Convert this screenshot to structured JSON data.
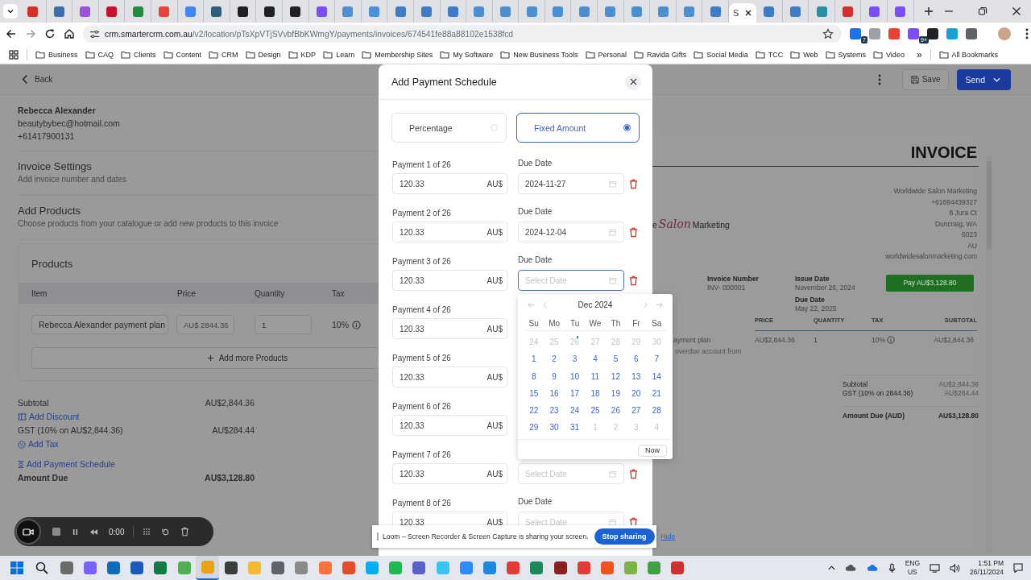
{
  "browser": {
    "tabs": [
      {
        "color": "#d93025",
        "selected": false
      },
      {
        "color": "#3b6db3",
        "selected": false
      },
      {
        "color": "#9b51e0",
        "selected": false
      },
      {
        "color": "#c8102e",
        "selected": false
      },
      {
        "color": "#1e8e3e",
        "selected": false
      },
      {
        "color": "#ea4335",
        "selected": false
      },
      {
        "color": "#4285f4",
        "selected": false
      },
      {
        "color": "#2d5f7a",
        "selected": false
      },
      {
        "color": "#202124",
        "selected": false
      },
      {
        "color": "#202124",
        "selected": false
      },
      {
        "color": "#202124",
        "selected": false
      },
      {
        "color": "#7c4dff",
        "selected": false
      },
      {
        "color": "#4a90d9",
        "selected": false
      },
      {
        "color": "#4a90d9",
        "selected": false
      },
      {
        "color": "#3d7cc9",
        "selected": false
      },
      {
        "color": "#3d7cc9",
        "selected": false
      },
      {
        "color": "#3d7cc9",
        "selected": false
      },
      {
        "color": "#4a8fd4",
        "selected": false
      },
      {
        "color": "#4a8fd4",
        "selected": false
      },
      {
        "color": "#4a8fd4",
        "selected": false
      },
      {
        "color": "#4a8fd4",
        "selected": false
      },
      {
        "color": "#4a8fd4",
        "selected": false
      },
      {
        "color": "#4a8fd4",
        "selected": false
      },
      {
        "color": "#4a8fd4",
        "selected": false
      },
      {
        "color": "#4a8fd4",
        "selected": false
      },
      {
        "color": "#4a8fd4",
        "selected": false
      },
      {
        "color": "#3d7cc9",
        "selected": false
      },
      {
        "title": "S",
        "selected": true
      },
      {
        "color": "#3d7cc9",
        "selected": false
      },
      {
        "color": "#3d7cc9",
        "selected": false
      },
      {
        "color": "#2a8fa0",
        "selected": false
      },
      {
        "color": "#d32f2f",
        "selected": false
      },
      {
        "color": "#7c4dff",
        "selected": false
      },
      {
        "color": "#7c4dff",
        "selected": false
      }
    ],
    "url": {
      "host": "crm.smartercrm.com.au",
      "path": "/v2/location/pTsXpVTjSVvbfBbKWmgY/payments/invoices/674541fe88a88102e1538fcd"
    },
    "extensions": [
      {
        "color": "#1a73e8",
        "badge": "7"
      },
      {
        "color": "#9aa0a6"
      },
      {
        "color": "#e94235"
      },
      {
        "color": "#7c4dff",
        "badge": "9+"
      },
      {
        "color": "#202124"
      },
      {
        "color": "#1a9fd8"
      },
      {
        "color": "#5f6368"
      }
    ],
    "bookmarks": [
      "Business",
      "CAQ",
      "Clients",
      "Content",
      "CRM",
      "Design",
      "KDP",
      "Learn",
      "Membership Sites",
      "My Software",
      "New Business Tools",
      "Personal",
      "Ravida Gifts",
      "Social Media",
      "TCC",
      "Web",
      "Systems",
      "Video"
    ],
    "overflow": "»",
    "all_bookmarks": "All Bookmarks"
  },
  "page": {
    "back": "Back",
    "save": "Save",
    "send": "Send",
    "customer": {
      "name": "Rebecca Alexander",
      "email": "beautybybec@hotmail.com",
      "phone": "+61417900131"
    },
    "sections": [
      {
        "title": "Invoice Settings",
        "subtitle": "Add invoice number and dates"
      },
      {
        "title": "Add Products",
        "subtitle": "Choose products from your catalogue or add new products to this invoice"
      }
    ],
    "products": {
      "title": "Products",
      "columns": [
        "Item",
        "Price",
        "Quantity",
        "Tax"
      ],
      "row": {
        "item": "Rebecca Alexander payment plan",
        "price": "AU$ 2844.36",
        "quantity": "1",
        "tax": "10%"
      },
      "add": "Add more Products"
    },
    "summary": [
      {
        "kind": "row",
        "label": "Subtotal",
        "value": "AU$2,844.36"
      },
      {
        "kind": "discount",
        "label": "Add Discount"
      },
      {
        "kind": "row",
        "label": "GST (10% on AU$2,844.36)",
        "value": "AU$284.44"
      },
      {
        "kind": "tax",
        "label": "Add Tax"
      },
      {
        "kind": "schedule",
        "label": "Add Payment Schedule"
      },
      {
        "kind": "total",
        "label": "Amount Due",
        "value": "AU$3,128.80"
      }
    ]
  },
  "invoice": {
    "heading": "INVOICE",
    "logo": {
      "lead": "e",
      "script": "Salon",
      "tail": "Marketing"
    },
    "company": [
      "Worldwide Salon Marketing",
      "+61894439327",
      "8 Jura Ct",
      "Duncraig, WA",
      "6023",
      "AU",
      "worldwidesalonmarketing.com"
    ],
    "number": {
      "label": "Invoice Number",
      "value": "INV- 000001"
    },
    "dates": [
      {
        "label": "Issue Date",
        "value": "November 26, 2024"
      },
      {
        "label": "Due Date",
        "value": "May 22, 2025"
      }
    ],
    "pay": "Pay AU$3,128.80",
    "columns": [
      "PRICE",
      "QUANTITY",
      "TAX",
      "SUBTOTAL"
    ],
    "item": {
      "name": "ayment plan",
      "note": "overdue account from",
      "price": "AU$2,844.36",
      "quantity": "1",
      "tax": "10%",
      "subtotal": "AU$2,844.36"
    },
    "totals": [
      {
        "label": "Subtotal",
        "value": "AU$2,844.36",
        "bold": false
      },
      {
        "label": "GST (10% on 2844.36)",
        "value": "AU$284.44",
        "bold": false
      },
      {
        "label": "Amount Due (AUD)",
        "value": "AU$3,128.80",
        "bold": true
      }
    ]
  },
  "modal": {
    "title": "Add Payment Schedule",
    "options": [
      {
        "label": "Percentage",
        "selected": false
      },
      {
        "label": "Fixed Amount",
        "selected": true
      }
    ],
    "payments": [
      {
        "label": "Payment 1 of 26",
        "amount": "120.33",
        "currency": "AU$",
        "due": {
          "label": "Due Date",
          "value": "2024-11-27",
          "focused": false
        }
      },
      {
        "label": "Payment 2 of 26",
        "amount": "120.33",
        "currency": "AU$",
        "due": {
          "label": "Due Date",
          "value": "2024-12-04",
          "focused": false
        }
      },
      {
        "label": "Payment 3 of 26",
        "amount": "120.33",
        "currency": "AU$",
        "due": {
          "label": "Due Date",
          "placeholder": "Select Date",
          "focused": true
        }
      },
      {
        "label": "Payment 4 of 26",
        "amount": "120.33",
        "currency": "AU$"
      },
      {
        "label": "Payment 5 of 26",
        "amount": "120.33",
        "currency": "AU$"
      },
      {
        "label": "Payment 6 of 26",
        "amount": "120.33",
        "currency": "AU$"
      },
      {
        "label": "Payment 7 of 26",
        "amount": "120.33",
        "currency": "AU$",
        "due": {
          "placeholder": "Select Date",
          "focused": false
        }
      },
      {
        "label": "Payment 8 of 26",
        "amount": "120.33",
        "currency": "AU$",
        "due": {
          "label": "Due Date",
          "placeholder": "Select Date",
          "focused": false
        }
      }
    ]
  },
  "calendar": {
    "month": "Dec 2024",
    "weekdays": [
      "Su",
      "Mo",
      "Tu",
      "We",
      "Th",
      "Fr",
      "Sa"
    ],
    "days": [
      {
        "text": "24",
        "outside": true,
        "today": false
      },
      {
        "text": "25",
        "outside": true,
        "today": false
      },
      {
        "text": "26",
        "outside": true,
        "today": true
      },
      {
        "text": "27",
        "outside": true,
        "today": false
      },
      {
        "text": "28",
        "outside": true,
        "today": false
      },
      {
        "text": "29",
        "outside": true,
        "today": false
      },
      {
        "text": "30",
        "outside": true,
        "today": false
      },
      {
        "text": "1",
        "outside": false,
        "today": false
      },
      {
        "text": "2",
        "outside": false,
        "today": false
      },
      {
        "text": "3",
        "outside": false,
        "today": false
      },
      {
        "text": "4",
        "outside": false,
        "today": false
      },
      {
        "text": "5",
        "outside": false,
        "today": false
      },
      {
        "text": "6",
        "outside": false,
        "today": false
      },
      {
        "text": "7",
        "outside": false,
        "today": false
      },
      {
        "text": "8",
        "outside": false,
        "today": false
      },
      {
        "text": "9",
        "outside": false,
        "today": false
      },
      {
        "text": "10",
        "outside": false,
        "today": false
      },
      {
        "text": "11",
        "outside": false,
        "today": false
      },
      {
        "text": "12",
        "outside": false,
        "today": false
      },
      {
        "text": "13",
        "outside": false,
        "today": false
      },
      {
        "text": "14",
        "outside": false,
        "today": false
      },
      {
        "text": "15",
        "outside": false,
        "today": false
      },
      {
        "text": "16",
        "outside": false,
        "today": false
      },
      {
        "text": "17",
        "outside": false,
        "today": false
      },
      {
        "text": "18",
        "outside": false,
        "today": false
      },
      {
        "text": "19",
        "outside": false,
        "today": false
      },
      {
        "text": "20",
        "outside": false,
        "today": false
      },
      {
        "text": "21",
        "outside": false,
        "today": false
      },
      {
        "text": "22",
        "outside": false,
        "today": false
      },
      {
        "text": "23",
        "outside": false,
        "today": false
      },
      {
        "text": "24",
        "outside": false,
        "today": false
      },
      {
        "text": "25",
        "outside": false,
        "today": false
      },
      {
        "text": "26",
        "outside": false,
        "today": false
      },
      {
        "text": "27",
        "outside": false,
        "today": false
      },
      {
        "text": "28",
        "outside": false,
        "today": false
      },
      {
        "text": "29",
        "outside": false,
        "today": false
      },
      {
        "text": "30",
        "outside": false,
        "today": false
      },
      {
        "text": "31",
        "outside": false,
        "today": false
      },
      {
        "text": "1",
        "outside": true,
        "today": false
      },
      {
        "text": "2",
        "outside": true,
        "today": false
      },
      {
        "text": "3",
        "outside": true,
        "today": false
      },
      {
        "text": "4",
        "outside": true,
        "today": false
      }
    ],
    "now": "Now"
  },
  "recorder": {
    "time": "0:00"
  },
  "loom_banner": {
    "message": "Loom – Screen Recorder & Screen Capture is sharing your screen.",
    "stop": "Stop sharing",
    "hide": "Hide"
  },
  "taskbar": {
    "apps": [
      {
        "color": "#6b6b6b",
        "selected": false
      },
      {
        "color": "#7b61ff",
        "selected": false
      },
      {
        "color": "#0f6cbd",
        "selected": false
      },
      {
        "color": "#185abd",
        "selected": false
      },
      {
        "color": "#107c41",
        "selected": false
      },
      {
        "color": "#4caf50",
        "selected": false
      },
      {
        "color": "#e8a317",
        "selected": true
      },
      {
        "color": "#3c3c3c",
        "selected": false
      },
      {
        "color": "#f2b931",
        "selected": false
      },
      {
        "color": "#5f6368",
        "selected": false
      },
      {
        "color": "#8a8a8a",
        "selected": false
      },
      {
        "color": "#ff7139",
        "selected": false
      },
      {
        "color": "#e44d26",
        "selected": false
      },
      {
        "color": "#00aff0",
        "selected": false
      },
      {
        "color": "#1db954",
        "selected": false
      },
      {
        "color": "#5b5fc7",
        "selected": false
      },
      {
        "color": "#36c5f0",
        "selected": false
      },
      {
        "color": "#2d8cff",
        "selected": false
      },
      {
        "color": "#1e88e5",
        "selected": false
      },
      {
        "color": "#e53935",
        "selected": false
      },
      {
        "color": "#1b8a5a",
        "selected": false
      },
      {
        "color": "#8b1e1e",
        "selected": false
      },
      {
        "color": "#e53935",
        "selected": false
      },
      {
        "color": "#f4511e",
        "selected": false
      },
      {
        "color": "#7cb342",
        "selected": false
      },
      {
        "color": "#43a047",
        "selected": false
      },
      {
        "color": "#d32f2f",
        "selected": false
      }
    ],
    "language": "ENG",
    "region": "US",
    "time": "1:51 PM",
    "date": "26/11/2024"
  }
}
